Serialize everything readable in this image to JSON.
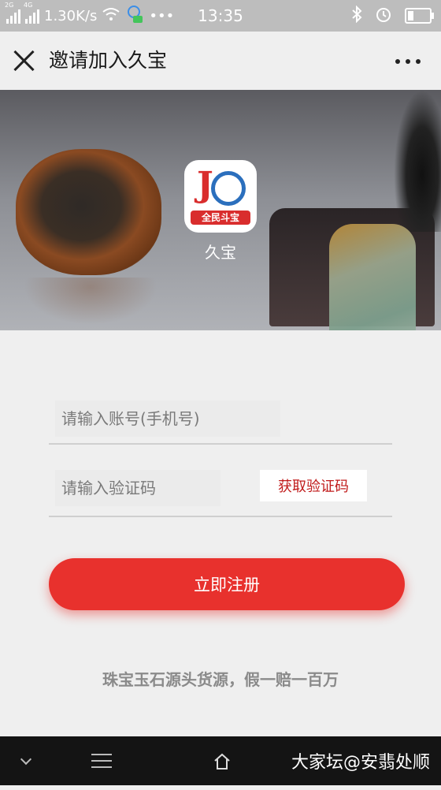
{
  "status_bar": {
    "net1": "2G",
    "net2": "4G",
    "speed": "1.30K/s",
    "time": "13:35",
    "more": "•••",
    "bluetooth_icon": "bluetooth-icon",
    "alarm_icon": "alarm-icon",
    "battery_level": 0.3
  },
  "header": {
    "title": "邀请加入久宝",
    "close_icon": "close-icon",
    "more_icon": "more-dots-icon"
  },
  "banner": {
    "logo_band_text": "全民斗宝",
    "app_name": "久宝"
  },
  "form": {
    "account_placeholder": "请输入账号(手机号)",
    "code_placeholder": "请输入验证码",
    "get_code_label": "获取验证码",
    "register_label": "立即注册"
  },
  "slogan": "珠宝玉石源头货源，假一赔一百万",
  "watermark": "大家坛@安翡处顺",
  "colors": {
    "accent": "#e8312d",
    "get_code_text": "#c01a1a"
  }
}
